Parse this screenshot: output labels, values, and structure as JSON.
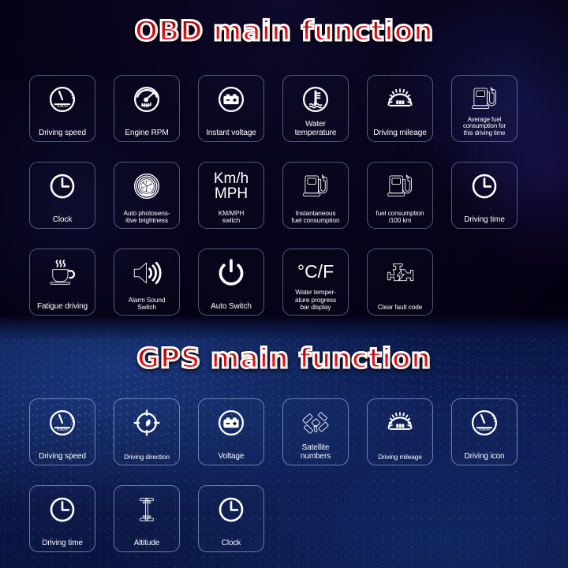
{
  "sections": [
    {
      "id": "obd",
      "title": "OBD main function",
      "items": [
        {
          "icon": "speedometer-icon",
          "label": "Driving speed",
          "size": "md"
        },
        {
          "icon": "tachometer-rpm-icon",
          "label": "Engine RPM",
          "size": "md"
        },
        {
          "icon": "battery-icon",
          "label": "Instant voltage",
          "size": "md"
        },
        {
          "icon": "water-temperature-icon",
          "label": "Water\ntemperature",
          "size": "md"
        },
        {
          "icon": "odometer-icon",
          "label": "Driving mileage",
          "size": "md"
        },
        {
          "icon": "fuel-pump-icon",
          "label": "Average fuel\nconsumption for\nthis driving time",
          "size": "xs"
        },
        {
          "icon": "clock-icon",
          "label": "Clock",
          "size": "md"
        },
        {
          "icon": "aperture-icon",
          "label": "Auto photosens-\nitive brightness",
          "size": "sm"
        },
        {
          "icon": "kmh-mph-text-icon",
          "label": "KM/MPH\nswitch",
          "size": "sm",
          "text_primary": "Km/h",
          "text_secondary": "MPH"
        },
        {
          "icon": "fuel-pump-icon",
          "label": "Instantaneous\nfuel consumption",
          "size": "sm"
        },
        {
          "icon": "fuel-pump-icon",
          "label": "fuel consumption\n/100 km",
          "size": "sm"
        },
        {
          "icon": "clock-icon",
          "label": "Driving time",
          "size": "md"
        },
        {
          "icon": "coffee-cup-icon",
          "label": "Fatigue driving",
          "size": "md"
        },
        {
          "icon": "speaker-volume-icon",
          "label": "Alarm Sound\nSwitch",
          "size": "sm"
        },
        {
          "icon": "power-icon",
          "label": "Auto Switch",
          "size": "md"
        },
        {
          "icon": "celsius-fahrenheit-text-icon",
          "label": "Water temper-\nature progress\nbar display",
          "size": "sm",
          "text_primary": "°C/F"
        },
        {
          "icon": "engine-check-icon",
          "label": "Clear fault code",
          "size": "sm"
        }
      ]
    },
    {
      "id": "gps",
      "title": "GPS main function",
      "items": [
        {
          "icon": "speedometer-icon",
          "label": "Driving speed",
          "size": "md"
        },
        {
          "icon": "compass-icon",
          "label": "Driving direction",
          "size": "sm"
        },
        {
          "icon": "battery-icon",
          "label": "Voltage",
          "size": "md"
        },
        {
          "icon": "satellite-icon",
          "label": "Satellite\nnumbers",
          "size": "md"
        },
        {
          "icon": "odometer-icon",
          "label": "Driving mileage",
          "size": "sm"
        },
        {
          "icon": "speedometer-icon",
          "label": "Driving icon",
          "size": "md"
        },
        {
          "icon": "clock-icon",
          "label": "Driving time",
          "size": "md"
        },
        {
          "icon": "altitude-icon",
          "label": "Altitude",
          "size": "md"
        },
        {
          "icon": "clock-icon",
          "label": "Clock",
          "size": "md"
        }
      ]
    }
  ],
  "colors": {
    "title_red": "#d40b0b",
    "title_outline": "#ffffff",
    "icon_white": "#ffffff",
    "top_background": "#05000f",
    "bottom_background": "#0c1a4d",
    "card_border": "#aabee6"
  }
}
